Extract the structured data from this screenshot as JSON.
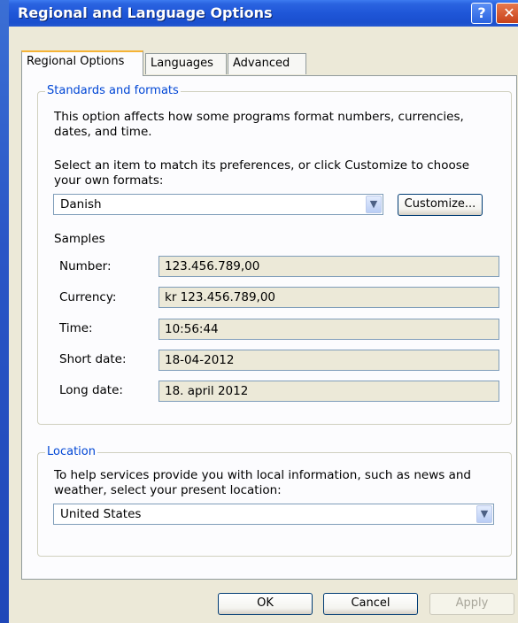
{
  "window": {
    "title": "Regional and Language Options",
    "help_glyph": "?",
    "close_glyph": "✕"
  },
  "tabs": [
    {
      "label": "Regional Options",
      "active": true
    },
    {
      "label": "Languages",
      "active": false
    },
    {
      "label": "Advanced",
      "active": false
    }
  ],
  "standards": {
    "legend": "Standards and formats",
    "description_line1": "This option affects how some programs format numbers, currencies,",
    "description_line2": "dates, and time.",
    "select_line1": "Select an item to match its preferences, or click Customize to choose",
    "select_line2": "your own formats:",
    "format_value": "Danish",
    "customize_label": "Customize...",
    "samples_heading": "Samples",
    "samples": [
      {
        "label": "Number:",
        "value": "123.456.789,00"
      },
      {
        "label": "Currency:",
        "value": "kr 123.456.789,00"
      },
      {
        "label": "Time:",
        "value": "10:56:44"
      },
      {
        "label": "Short date:",
        "value": "18-04-2012"
      },
      {
        "label": "Long date:",
        "value": "18. april 2012"
      }
    ]
  },
  "location": {
    "legend": "Location",
    "description_line1": "To help services provide you with local information, such as news and",
    "description_line2": "weather, select your present location:",
    "value": "United States"
  },
  "footer": {
    "ok_label": "OK",
    "cancel_label": "Cancel",
    "apply_label": "Apply",
    "apply_enabled": false
  },
  "icons": {
    "dropdown": "chevron-down-icon"
  },
  "colors": {
    "titlebar": "#1f56d8",
    "legend_text": "#0046d5",
    "dialog_bg": "#ece9d8",
    "tab_highlight": "#f5b335"
  }
}
